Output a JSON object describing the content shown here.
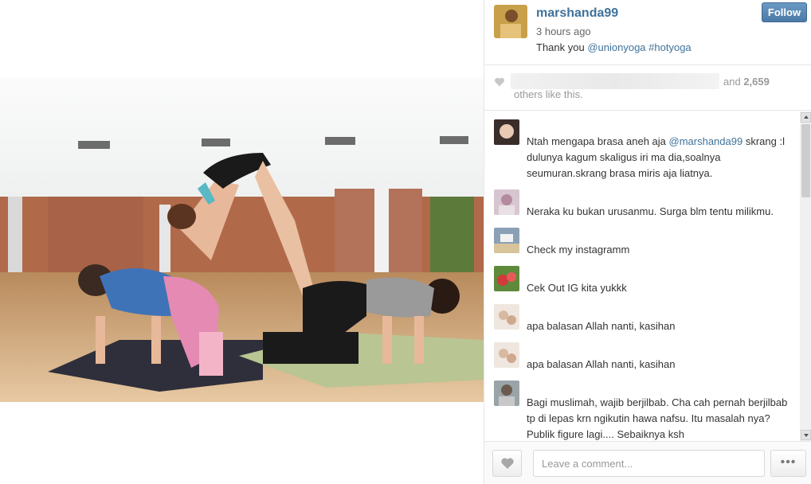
{
  "post": {
    "username": "marshanda99",
    "time": "3 hours ago",
    "caption_text": "Thank you ",
    "caption_mention": "@unionyoga",
    "caption_hashtag": "#hotyoga",
    "follow_label": "Follow"
  },
  "likes": {
    "and_text": "and",
    "count": "2,659",
    "others_text": "others like this."
  },
  "comments": [
    {
      "text_before": "Ntah mengapa brasa aneh aja ",
      "mention": "@marshanda99",
      "text_after": " skrang :l dulunya kagum skaligus iri ma dia,soalnya seumuran.skrang brasa miris aja liatnya."
    },
    {
      "text_before": "Neraka ku bukan urusanmu. Surga blm tentu milikmu.",
      "mention": "",
      "text_after": ""
    },
    {
      "text_before": "Check my instagramm",
      "mention": "",
      "text_after": ""
    },
    {
      "text_before": "Cek Out IG kita yukkk",
      "mention": "",
      "text_after": ""
    },
    {
      "text_before": "apa balasan Allah nanti, kasihan",
      "mention": "",
      "text_after": ""
    },
    {
      "text_before": "apa balasan Allah nanti, kasihan",
      "mention": "",
      "text_after": ""
    },
    {
      "text_before": "Bagi muslimah, wajib berjilbab. Cha cah pernah berjilbab tp di lepas krn ngikutin hawa nafsu. Itu masalah nya? Publik figure lagi.... Sebaiknya ksh",
      "mention": "",
      "text_after": ""
    }
  ],
  "footer": {
    "comment_placeholder": "Leave a comment...",
    "more_label": "•••"
  },
  "colors": {
    "link": "#3f729b",
    "follow_button": "#517fa4"
  }
}
